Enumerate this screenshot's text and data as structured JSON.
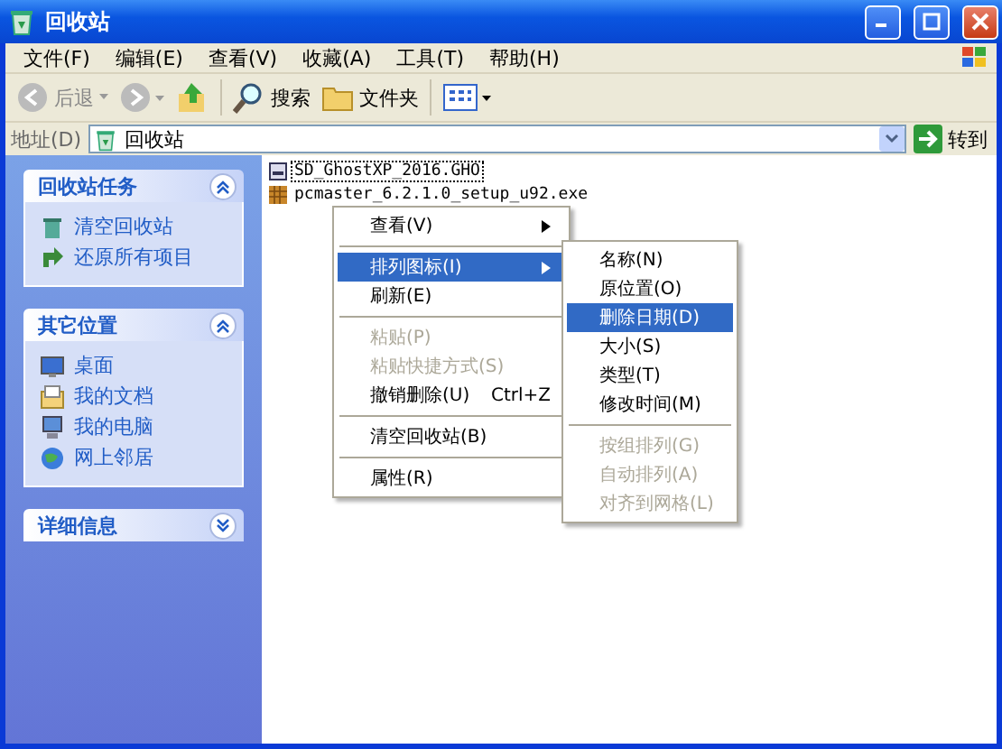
{
  "window": {
    "title": "回收站"
  },
  "menu_bar": [
    "文件(F)",
    "编辑(E)",
    "查看(V)",
    "收藏(A)",
    "工具(T)",
    "帮助(H)"
  ],
  "toolbar": {
    "back": "后退",
    "search": "搜索",
    "folders": "文件夹"
  },
  "address": {
    "label": "地址(D)",
    "value": "回收站",
    "go": "转到"
  },
  "sidebar": [
    {
      "title": "回收站任务",
      "expanded": true,
      "items": [
        {
          "label": "清空回收站"
        },
        {
          "label": "还原所有项目"
        }
      ]
    },
    {
      "title": "其它位置",
      "expanded": true,
      "items": [
        {
          "label": "桌面"
        },
        {
          "label": "我的文档"
        },
        {
          "label": "我的电脑"
        },
        {
          "label": "网上邻居"
        }
      ]
    },
    {
      "title": "详细信息",
      "expanded": false
    }
  ],
  "files": [
    {
      "name": "SD_GhostXP_2016.GHO",
      "selected": true
    },
    {
      "name": "pcmaster_6.2.1.0_setup_u92.exe",
      "selected": false
    }
  ],
  "context_menu": [
    {
      "kind": "item",
      "label": "查看(V)",
      "submenu": true,
      "disabled": false,
      "selected": false
    },
    {
      "kind": "separator"
    },
    {
      "kind": "item",
      "label": "排列图标(I)",
      "submenu": true,
      "disabled": false,
      "selected": true
    },
    {
      "kind": "item",
      "label": "刷新(E)",
      "submenu": false,
      "disabled": false,
      "selected": false
    },
    {
      "kind": "separator"
    },
    {
      "kind": "item",
      "label": "粘贴(P)",
      "submenu": false,
      "disabled": true,
      "selected": false
    },
    {
      "kind": "item",
      "label": "粘贴快捷方式(S)",
      "submenu": false,
      "disabled": true,
      "selected": false
    },
    {
      "kind": "item",
      "label": "撤销删除(U)",
      "shortcut": "Ctrl+Z",
      "submenu": false,
      "disabled": false,
      "selected": false
    },
    {
      "kind": "separator"
    },
    {
      "kind": "item",
      "label": "清空回收站(B)",
      "submenu": false,
      "disabled": false,
      "selected": false
    },
    {
      "kind": "separator"
    },
    {
      "kind": "item",
      "label": "属性(R)",
      "submenu": false,
      "disabled": false,
      "selected": false
    }
  ],
  "submenu": [
    {
      "kind": "item",
      "label": "名称(N)",
      "disabled": false,
      "selected": false
    },
    {
      "kind": "item",
      "label": "原位置(O)",
      "disabled": false,
      "selected": false
    },
    {
      "kind": "item",
      "label": "删除日期(D)",
      "disabled": false,
      "selected": true
    },
    {
      "kind": "item",
      "label": "大小(S)",
      "disabled": false,
      "selected": false
    },
    {
      "kind": "item",
      "label": "类型(T)",
      "disabled": false,
      "selected": false
    },
    {
      "kind": "item",
      "label": "修改时间(M)",
      "disabled": false,
      "selected": false
    },
    {
      "kind": "separator"
    },
    {
      "kind": "item",
      "label": "按组排列(G)",
      "disabled": true,
      "selected": false
    },
    {
      "kind": "item",
      "label": "自动排列(A)",
      "disabled": true,
      "selected": false
    },
    {
      "kind": "item",
      "label": "对齐到网格(L)",
      "disabled": true,
      "selected": false
    }
  ]
}
